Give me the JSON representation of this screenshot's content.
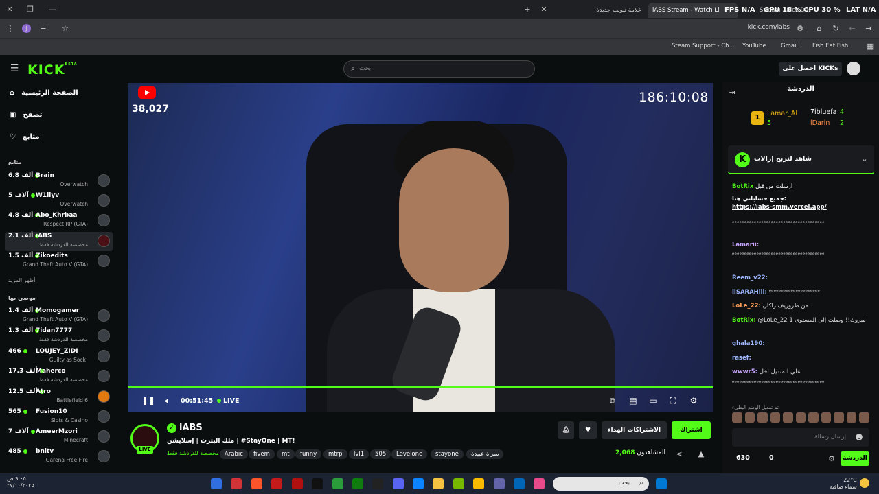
{
  "browser": {
    "tabs": [
      {
        "label": "علامة تبويب جديدة"
      },
      {
        "label": "iABS Stream - Watch Li"
      },
      {
        "label": "Stream - Kick Dashboard"
      }
    ],
    "url": "kick.com/iabs",
    "profile_letter": "J",
    "bookmarks": [
      {
        "label": "Fish Eat Fish"
      },
      {
        "label": "Gmail"
      },
      {
        "label": "YouTube"
      },
      {
        "label": "Steam Support - Ch..."
      }
    ]
  },
  "perf_overlay": {
    "fps_label": "FPS",
    "fps_value": "N/A",
    "gpu_label": "GPU",
    "gpu_value": "18 %",
    "cpu_label": "CPU",
    "cpu_value": "30 %",
    "lat_label": "LAT",
    "lat_value": "N/A"
  },
  "header": {
    "logo": "KICK",
    "logo_badge": "BETA",
    "search_placeholder": "بحث",
    "get_kicks": "احصل على KICKs"
  },
  "sidebar": {
    "nav": [
      {
        "label": "الصفحة الرئيسية",
        "icon": "home-icon"
      },
      {
        "label": "تصفح",
        "icon": "browse-icon"
      },
      {
        "label": "متابع",
        "icon": "heart-icon"
      }
    ],
    "following_title": "متابع",
    "following": [
      {
        "name": "Brain",
        "viewers": "6.8 ألف",
        "category": "Overwatch"
      },
      {
        "name": "W1llyv",
        "viewers": "5 آلاف",
        "category": "Overwatch"
      },
      {
        "name": "Abo_Khrbaa",
        "viewers": "4.8 ألف",
        "category": "Respect RP (GTA)"
      },
      {
        "name": "iABS",
        "viewers": "2.1 ألف",
        "category": "مخصصة للدردشة فقط"
      },
      {
        "name": "Zikoedits",
        "viewers": "1.5 ألف",
        "category": "Grand Theft Auto V (GTA)"
      }
    ],
    "show_more": "أظهر المزيد",
    "recommended_title": "موصى بها",
    "recommended": [
      {
        "name": "Momogamer",
        "viewers": "1.4 ألف",
        "category": "Grand Theft Auto V (GTA)"
      },
      {
        "name": "7idan7777",
        "viewers": "1.3 ألف",
        "category": "مخصصة للدردشة فقط"
      },
      {
        "name": "LOUJEY_ZIDI",
        "viewers": "466",
        "category": "Guilty as Sock!"
      },
      {
        "name": "Maherco",
        "viewers": "17.3 ألف",
        "category": "مخصصة للدردشة فقط"
      },
      {
        "name": "Atro",
        "viewers": "12.5 ألف",
        "category": "Battlefield 6"
      },
      {
        "name": "Fusion10",
        "viewers": "565",
        "category": "Slots & Casino"
      },
      {
        "name": "AmeerMzori",
        "viewers": "7 آلاف",
        "category": "Minecraft"
      },
      {
        "name": "bnltv",
        "viewers": "485",
        "category": "Garena Free Fire"
      }
    ]
  },
  "video": {
    "viewer_count": "38,027",
    "timer": "186:10:08",
    "elapsed": "00:51:45",
    "live_label": "LIVE",
    "progress": 1.0
  },
  "channel": {
    "name": "iABS",
    "live_badge": "LIVE",
    "title": "ملك البثرث | إسلايشن | #StayOne | MT!",
    "category": "مخصصة للدردشة فقط",
    "tags": [
      "Arabic",
      "fivem",
      "mt",
      "funny",
      "mtrp",
      "lvl1",
      "505",
      "Levelone",
      "stayone",
      "سراة عبيدة"
    ],
    "subscribe": "اشتراك",
    "gift_subs": "الاشتراكات الهداء",
    "viewers_label": "المشاهدون",
    "viewers_value": "2,068"
  },
  "chat": {
    "title": "الدردشة",
    "leaderboard": [
      {
        "name": "Lamar_AI",
        "count": "5",
        "rank": "1"
      },
      {
        "name": "7ibluefa",
        "count": "4"
      },
      {
        "name": "lDarin",
        "count": "2"
      }
    ],
    "pinned": "شاهد لتربح إزالات",
    "bot_message": {
      "user": "BotRix",
      "text": "جميع حساباتي هنا:",
      "link": "https://iabs-smm.vercel.app/",
      "label": "أرسلت من قبل"
    },
    "messages": [
      {
        "user": "",
        "text": "ᵉᵉᵉᵉᵉᵉᵉᵉᵉᵉᵉᵉᵉᵉᵉᵉᵉᵉᵉᵉᵉᵉᵉᵉᵉᵉᵉᵉᵉᵉᵉᵉᵉᵉᵉᵉᵉᵉ"
      },
      {
        "user": "Lamarii:",
        "text": "ᵉᵉᵉᵉᵉᵉᵉᵉᵉᵉᵉᵉᵉᵉᵉᵉᵉᵉᵉᵉᵉᵉᵉᵉᵉᵉᵉᵉᵉᵉᵉᵉᵉᵉᵉᵉᵉᵉ"
      },
      {
        "user": "Reem_v22:",
        "text": ""
      },
      {
        "user": "iiSARAHiii:",
        "text": "ᵉᵉᵉᵉᵉᵉᵉᵉᵉᵉᵉᵉᵉᵉᵉᵉᵉᵉᵉᵉᵉ"
      },
      {
        "user": "LoLe_22:",
        "text": "من طروريف راكان"
      },
      {
        "user": "BotRix:",
        "text": "@LoLe_22 مبروك!! وصلت إلى المستوى 1!"
      },
      {
        "user": "ghala190:",
        "text": ""
      },
      {
        "user": "rasef:",
        "text": ""
      },
      {
        "user": "wwwr5:",
        "text": "علي المنديل اخل"
      },
      {
        "user": "",
        "text": "ᵉᵉᵉᵉᵉᵉᵉᵉᵉᵉᵉᵉᵉᵉᵉᵉᵉᵉᵉᵉᵉᵉᵉᵉᵉᵉᵉᵉᵉᵉᵉᵉᵉᵉᵉᵉᵉᵉ"
      }
    ],
    "emote_mode_note": "تم تفعيل الوضع البطيء",
    "input_placeholder": "إرسال رسالة",
    "send_label": "الدردشة",
    "points": "630",
    "gifts": "0"
  },
  "taskbar": {
    "search_placeholder": "بحث",
    "weather_temp": "22°C",
    "weather_desc": "سماء صافية",
    "time": "٩:٠٥ ص",
    "date": "٢٧/١٠/٢٠٢٥"
  },
  "colors": {
    "accent": "#53fc18",
    "bg": "#0b0e0f"
  }
}
